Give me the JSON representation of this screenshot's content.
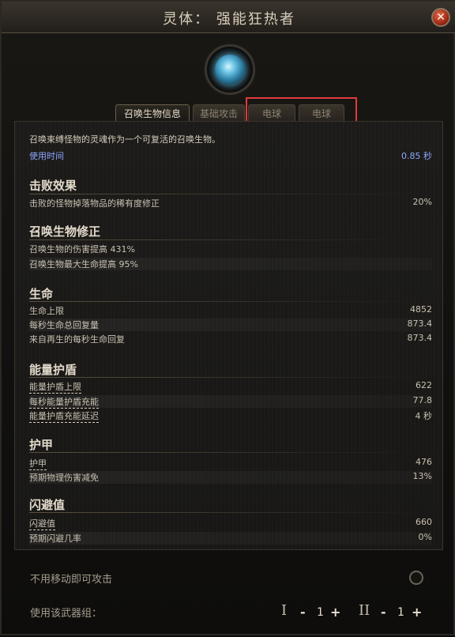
{
  "window": {
    "title": "灵体： 强能狂热者",
    "close_icon": "close-icon"
  },
  "portrait": {
    "icon": "electric-orb-icon"
  },
  "tabs": [
    "召唤生物信息",
    "基础攻击",
    "电球",
    "电球"
  ],
  "intro": "召唤束缚怪物的灵魂作为一个可复活的召唤生物。",
  "use_time": {
    "label": "使用时间",
    "value": "0.85 秒"
  },
  "sections": {
    "defeat": {
      "title": "击败效果",
      "rows": [
        {
          "label": "击败的怪物掉落物品的稀有度修正",
          "value": "20%"
        }
      ]
    },
    "minion_mod": {
      "title": "召唤生物修正",
      "rows": [
        {
          "label": "召唤生物的伤害提高 431%",
          "value": ""
        },
        {
          "label": "召唤生物最大生命提高 95%",
          "value": ""
        }
      ]
    },
    "life": {
      "title": "生命",
      "rows": [
        {
          "label": "生命上限",
          "value": "4852"
        },
        {
          "label": "每秒生命总回复量",
          "value": "873.4"
        },
        {
          "label": "来自再生的每秒生命回复",
          "value": "873.4"
        }
      ]
    },
    "es": {
      "title": "能量护盾",
      "rows": [
        {
          "label": "能量护盾上限",
          "value": "622"
        },
        {
          "label": "每秒能量护盾充能",
          "value": "77.8"
        },
        {
          "label": "能量护盾充能延迟",
          "value": "4 秒"
        }
      ]
    },
    "armour": {
      "title": "护甲",
      "rows": [
        {
          "label": "护甲",
          "value": "476"
        },
        {
          "label": "预期物理伤害减免",
          "value": "13%"
        }
      ]
    },
    "evasion": {
      "title": "闪避值",
      "rows": [
        {
          "label": "闪避值",
          "value": "660"
        },
        {
          "label": "预期闪避几率",
          "value": "0%"
        }
      ]
    }
  },
  "bottom": {
    "no_move_attack": "不用移动即可攻击",
    "weapon_set_label": "使用该武器组：",
    "set1": {
      "numeral": "I",
      "minus": "-",
      "count": "1",
      "plus": "+"
    },
    "set2": {
      "numeral": "II",
      "minus": "-",
      "count": "1",
      "plus": "+"
    }
  }
}
